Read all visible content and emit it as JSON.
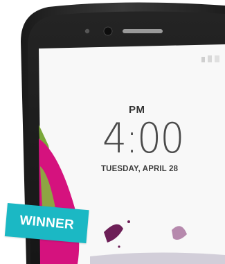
{
  "lockscreen": {
    "ampm": "PM",
    "time": "4:00",
    "date": "TUESDAY, APRIL 28"
  },
  "badge": {
    "label": "WINNER"
  },
  "colors": {
    "phone_frame": "#2a2a2a",
    "screen": "#f7f7f7",
    "wallpaper_magenta": "#d5127e",
    "wallpaper_green": "#7ba83a",
    "badge": "#1bb8c4"
  }
}
